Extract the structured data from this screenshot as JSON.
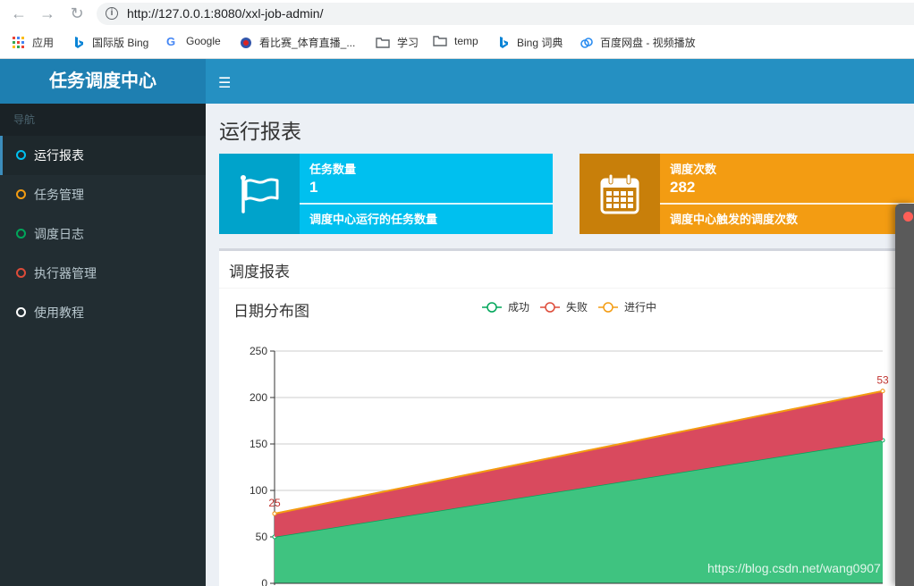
{
  "browser": {
    "url": "http://127.0.0.1:8080/xxl-job-admin/",
    "bookmarks": [
      {
        "label": "应用",
        "icon": "apps-grid-icon"
      },
      {
        "label": "国际版 Bing",
        "icon": "bing-icon"
      },
      {
        "label": "Google",
        "icon": "google-icon"
      },
      {
        "label": "看比赛_体育直播_...",
        "icon": "sports-icon"
      },
      {
        "label": "学习",
        "icon": "folder-icon"
      },
      {
        "label": "temp",
        "icon": "folder-icon"
      },
      {
        "label": "Bing 词典",
        "icon": "bing-icon"
      },
      {
        "label": "百度网盘 - 视频播放",
        "icon": "baidu-cloud-icon"
      }
    ]
  },
  "app": {
    "title": "任务调度中心"
  },
  "sidebar": {
    "header": "导航",
    "items": [
      {
        "label": "运行报表",
        "color": "#00c0ef",
        "active": true
      },
      {
        "label": "任务管理",
        "color": "#f39c12"
      },
      {
        "label": "调度日志",
        "color": "#00a65a"
      },
      {
        "label": "执行器管理",
        "color": "#dd4b39"
      },
      {
        "label": "使用教程",
        "color": "#ffffff"
      }
    ]
  },
  "page": {
    "title": "运行报表"
  },
  "info_boxes": [
    {
      "label": "任务数量",
      "value": "1",
      "desc": "调度中心运行的任务数量",
      "color": "#00c0ef",
      "icon_bg": "#00a3cb",
      "icon": "flag-icon"
    },
    {
      "label": "调度次数",
      "value": "282",
      "desc": "调度中心触发的调度次数",
      "color": "#f39c12",
      "icon_bg": "#c87f0a",
      "icon": "calendar-icon"
    }
  ],
  "report": {
    "title": "调度报表"
  },
  "chart_data": {
    "type": "area",
    "title": "日期分布图",
    "legend_position": "top-center",
    "series": [
      {
        "name": "成功",
        "values": [
          50,
          154
        ],
        "color": "#00a65a"
      },
      {
        "name": "失败",
        "values": [
          25,
          53
        ],
        "color": "#dd4b39"
      },
      {
        "name": "进行中",
        "values": [
          0,
          0
        ],
        "color": "#f39c12"
      }
    ],
    "stacked": true,
    "ylim": [
      0,
      250
    ],
    "yticks": [
      "250",
      "200",
      "150",
      "100",
      "50",
      "0"
    ],
    "data_labels": [
      "25",
      "53"
    ]
  },
  "watermark": "https://blog.csdn.net/wang0907"
}
